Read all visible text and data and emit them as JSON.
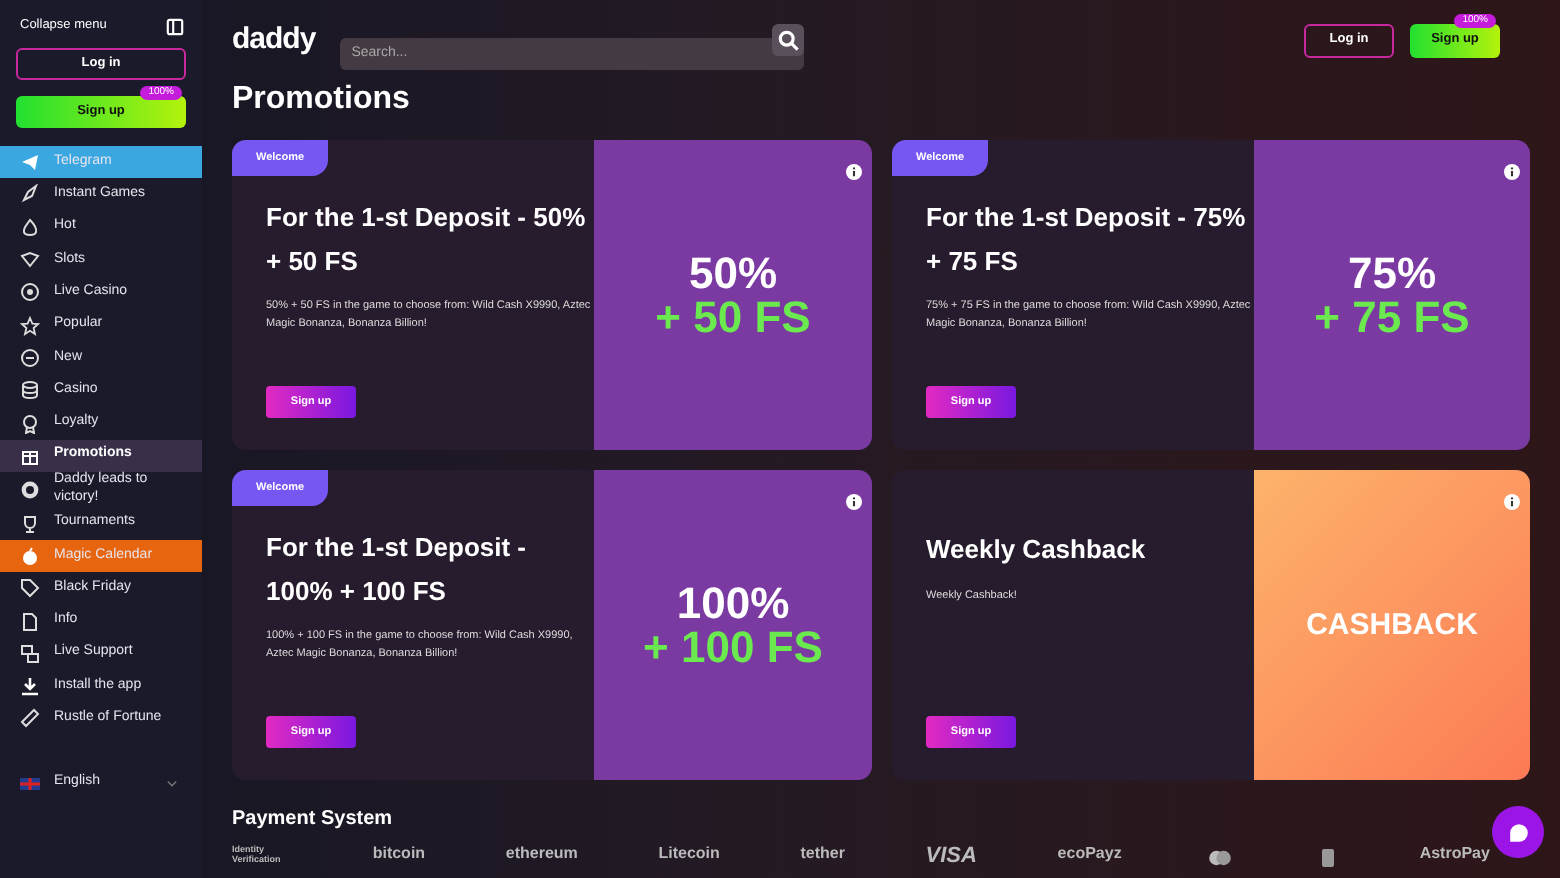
{
  "sidebar": {
    "collapse_label": "Collapse menu",
    "login": "Log in",
    "signup": "Sign up",
    "signup_badge": "100%",
    "items": [
      {
        "label": "Telegram",
        "selected": false,
        "kind": "banner",
        "color": "#3aa7e0"
      },
      {
        "label": "Instant Games",
        "selected": false,
        "kind": "plain"
      },
      {
        "label": "Hot",
        "selected": false,
        "kind": "plain"
      },
      {
        "label": "Slots",
        "selected": false,
        "kind": "plain"
      },
      {
        "label": "Live Casino",
        "selected": false,
        "kind": "plain"
      },
      {
        "label": "Popular",
        "selected": false,
        "kind": "plain"
      },
      {
        "label": "New",
        "selected": false,
        "kind": "plain"
      },
      {
        "label": "Casino",
        "selected": false,
        "kind": "plain"
      },
      {
        "label": "Loyalty",
        "selected": false,
        "kind": "plain"
      },
      {
        "label": "Promotions",
        "selected": true,
        "kind": "plain"
      },
      {
        "label": "Daddy leads to victory!",
        "selected": false,
        "kind": "plain"
      },
      {
        "label": "Tournaments",
        "selected": false,
        "kind": "plain"
      },
      {
        "label": "Magic Calendar",
        "selected": false,
        "kind": "banner",
        "color": "#e8650f"
      },
      {
        "label": "Black Friday",
        "selected": false,
        "kind": "plain"
      },
      {
        "label": "Info",
        "selected": false,
        "kind": "plain"
      },
      {
        "label": "Live Support",
        "selected": false,
        "kind": "plain"
      },
      {
        "label": "Install the app",
        "selected": false,
        "kind": "plain"
      },
      {
        "label": "Rustle of Fortune",
        "selected": false,
        "kind": "plain"
      }
    ],
    "language": "English"
  },
  "header": {
    "logo": "daddy",
    "search": {
      "placeholder": "Search..."
    },
    "login": "Log in",
    "signup": "Sign up",
    "signup_badge": "100%"
  },
  "title": "Promotions",
  "promotions": [
    {
      "tag": "Welcome",
      "title": "For the 1-st Deposit - 50% + 50 FS",
      "description": "50% + 50 FS in the game to choose from: Wild Cash X9990, Aztec Magic Bonanza, Bonanza Billion!",
      "button": "Sign up",
      "art": {
        "kind": "bonus",
        "lines": [
          "50%",
          "+ 50 FS"
        ]
      }
    },
    {
      "tag": "Welcome",
      "title": "For the 1-st Deposit - 75% + 75 FS",
      "description": "75% + 75 FS in the game to choose from: Wild Cash X9990, Aztec Magic Bonanza, Bonanza Billion!",
      "button": "Sign up",
      "art": {
        "kind": "bonus",
        "lines": [
          "75%",
          "+ 75 FS"
        ]
      }
    },
    {
      "tag": "Welcome",
      "title": "For the 1-st Deposit - 100% + 100 FS",
      "description": "100% + 100 FS in the game to choose from: Wild Cash X9990, Aztec Magic Bonanza, Bonanza Billion!",
      "button": "Sign up",
      "art": {
        "kind": "bonus",
        "lines": [
          "100%",
          "+ 100 FS"
        ]
      }
    },
    {
      "title": "Weekly Cashback",
      "description": "Weekly Cashback!",
      "button": "Sign up",
      "art": {
        "kind": "cashback",
        "lines": [
          "CASHBACK"
        ]
      }
    }
  ],
  "payment_system": {
    "title": "Payment System",
    "methods": [
      {
        "kind": "text",
        "label": "Identity Verification"
      },
      {
        "kind": "text",
        "label": "bitcoin"
      },
      {
        "kind": "text",
        "label": "ethereum"
      },
      {
        "kind": "text",
        "label": "Litecoin"
      },
      {
        "kind": "text",
        "label": "tether"
      },
      {
        "kind": "text",
        "label": "VISA"
      },
      {
        "kind": "text",
        "label": "ecoPayz"
      },
      {
        "kind": "icon"
      },
      {
        "kind": "icon"
      },
      {
        "kind": "text",
        "label": "AstroPay"
      }
    ]
  }
}
